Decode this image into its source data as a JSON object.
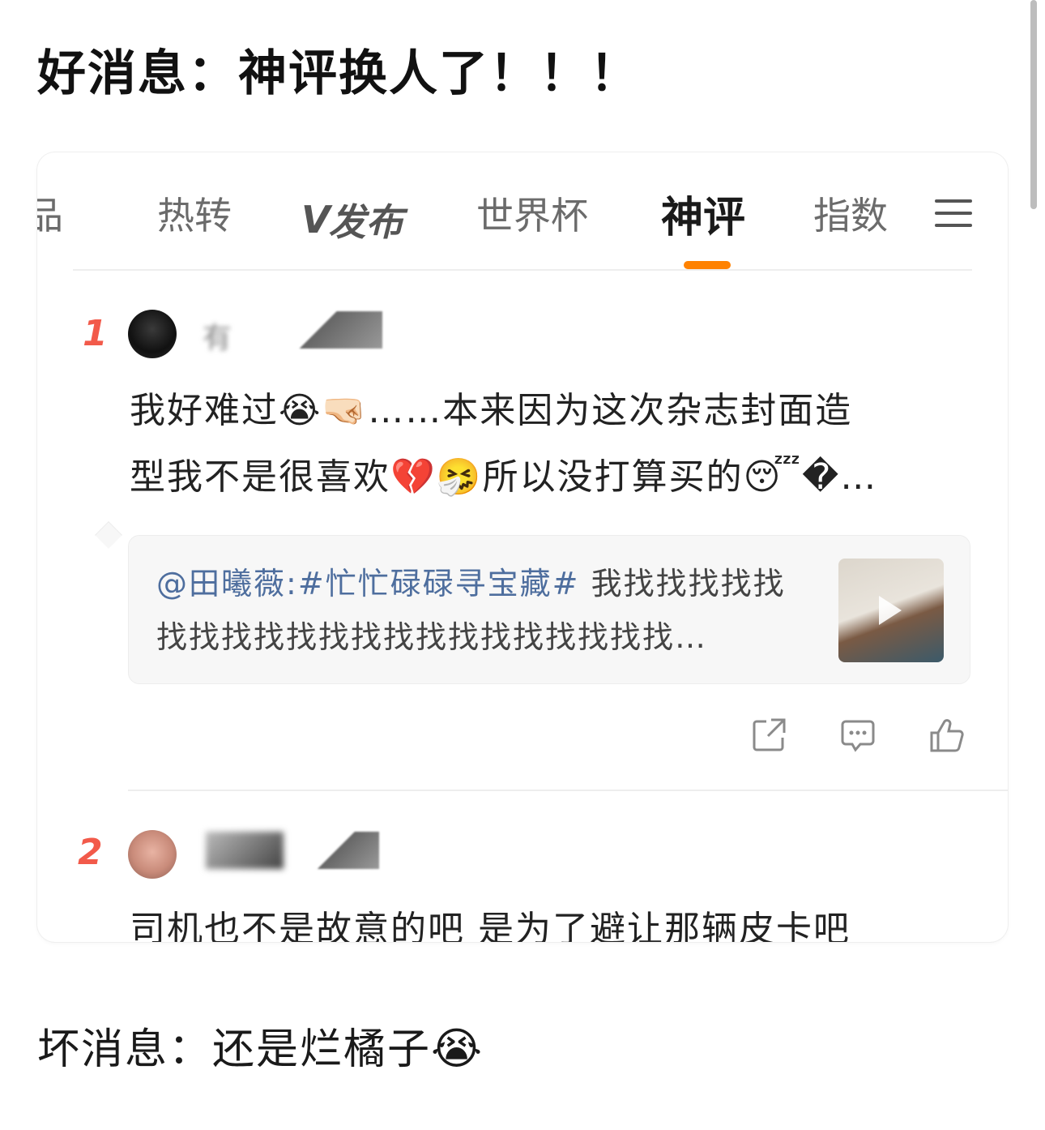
{
  "post": {
    "title": "好消息：神评换人了！！！",
    "footer": "坏消息：还是烂橘子",
    "footer_emoji": "😭"
  },
  "tabs": {
    "items": [
      {
        "label": "品",
        "state": "partial"
      },
      {
        "label": "热转"
      },
      {
        "label": "发布",
        "logo": "V"
      },
      {
        "label": "世界杯"
      },
      {
        "label": "神评",
        "active": true
      },
      {
        "label": "指数"
      }
    ],
    "menu_icon": "hamburger-menu-icon",
    "active_color": "#ff8200"
  },
  "comments": [
    {
      "rank": "1",
      "username": "有",
      "text_line1": "我好难过😭🤜🏻……本来因为这次杂志封面造",
      "text_line2": "型我不是很喜欢💔🤧所以没打算买的😴�…",
      "quote": {
        "mention": "@田曦薇:",
        "hashtag": "#忙忙碌碌寻宝藏#",
        "line1_rest": " 我找找找找找",
        "line2": "找找找找找找找找找找找找找找找找…"
      },
      "actions": [
        "share-icon",
        "comment-icon",
        "like-icon"
      ]
    },
    {
      "rank": "2",
      "text": "司机也不是故意的吧 是为了避让那辆皮卡吧"
    }
  ],
  "colors": {
    "rank": "#f25a4a",
    "link": "#4e6e9e",
    "accent": "#ff8200"
  }
}
